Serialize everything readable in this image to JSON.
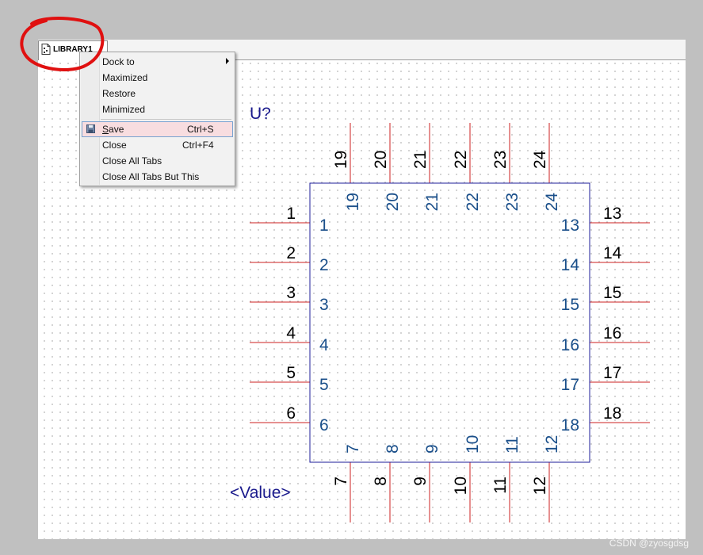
{
  "tab": {
    "title": "LIBRARY1",
    "icon": "document-icon"
  },
  "context_menu": {
    "items": [
      {
        "label": "Dock to",
        "shortcut": "",
        "has_submenu": true
      },
      {
        "label": "Maximized",
        "shortcut": ""
      },
      {
        "label": "Restore",
        "shortcut": ""
      },
      {
        "label": "Minimized",
        "shortcut": ""
      },
      {
        "label": "Save",
        "shortcut": "Ctrl+S",
        "icon": "save-icon",
        "selected": true
      },
      {
        "label": "Close",
        "shortcut": "Ctrl+F4"
      },
      {
        "label": "Close All Tabs",
        "shortcut": ""
      },
      {
        "label": "Close All Tabs But This",
        "shortcut": ""
      }
    ]
  },
  "component": {
    "reference": "U?",
    "value": "<Value>",
    "pins_left": [
      "1",
      "2",
      "3",
      "4",
      "5",
      "6"
    ],
    "pins_right": [
      "13",
      "14",
      "15",
      "16",
      "17",
      "18"
    ],
    "pins_top": [
      "19",
      "20",
      "21",
      "22",
      "23",
      "24"
    ],
    "pins_bottom": [
      "7",
      "8",
      "9",
      "10",
      "11",
      "12"
    ]
  },
  "watermark": "CSDN @zyosgdsg",
  "colors": {
    "pin_line": "#cc2222",
    "body_outline": "#1c1c9a",
    "pin_internal_text": "#1a4f8a",
    "reference_text": "#1a1a8c",
    "annotation_circle": "#e01010",
    "menu_highlight": "#f8dde0"
  }
}
